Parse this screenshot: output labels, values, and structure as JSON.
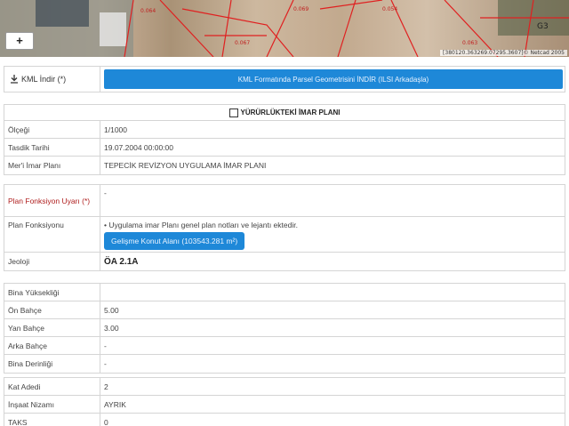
{
  "map": {
    "zoom_in_label": "+",
    "attribution": "[380120.363269.07295.3607]© Netcad 2005",
    "parcel_labels": [
      "0.064",
      "0.067",
      "0.069",
      "0.054",
      "0.063",
      "G3"
    ]
  },
  "kml": {
    "label": "KML İndir (*)",
    "button": "KML Formatında Parsel Geometrisini İNDİR (ILSI Arkadaşla)"
  },
  "plan": {
    "section_title": "YÜRÜRLÜKTEKİ İMAR PLANI",
    "rows": [
      {
        "label": "Ölçeği",
        "value": "1/1000"
      },
      {
        "label": "Tasdik Tarihi",
        "value": "19.07.2004 00:00:00"
      },
      {
        "label": "Mer'i İmar Planı",
        "value": "TEPECİK REVİZYON UYGULAMA İMAR PLANI"
      }
    ]
  },
  "fonksiyon": {
    "uyari_label": "Plan Fonksiyon Uyarı (*)",
    "uyari_value": "-",
    "label": "Plan Fonksiyonu",
    "note": "• Uygulama imar Planı genel plan notları ve lejantı ektedir.",
    "chip": "Gelişme Konut Alanı (103543.281 m²)",
    "jeoloji_label": "Jeoloji",
    "jeoloji_value": "ÖA 2.1A"
  },
  "bina": {
    "rows": [
      {
        "label": "Bina Yüksekliği",
        "value": ""
      },
      {
        "label": "Ön Bahçe",
        "value": "5.00"
      },
      {
        "label": "Yan Bahçe",
        "value": "3.00"
      },
      {
        "label": "Arka Bahçe",
        "value": "-"
      },
      {
        "label": "Bina Derinliği",
        "value": "-"
      }
    ]
  },
  "kat": {
    "rows": [
      {
        "label": "Kat Adedi",
        "value": "2"
      },
      {
        "label": "İnşaat Nizamı",
        "value": "AYRIK"
      },
      {
        "label": "TAKS",
        "value": "0"
      }
    ]
  }
}
